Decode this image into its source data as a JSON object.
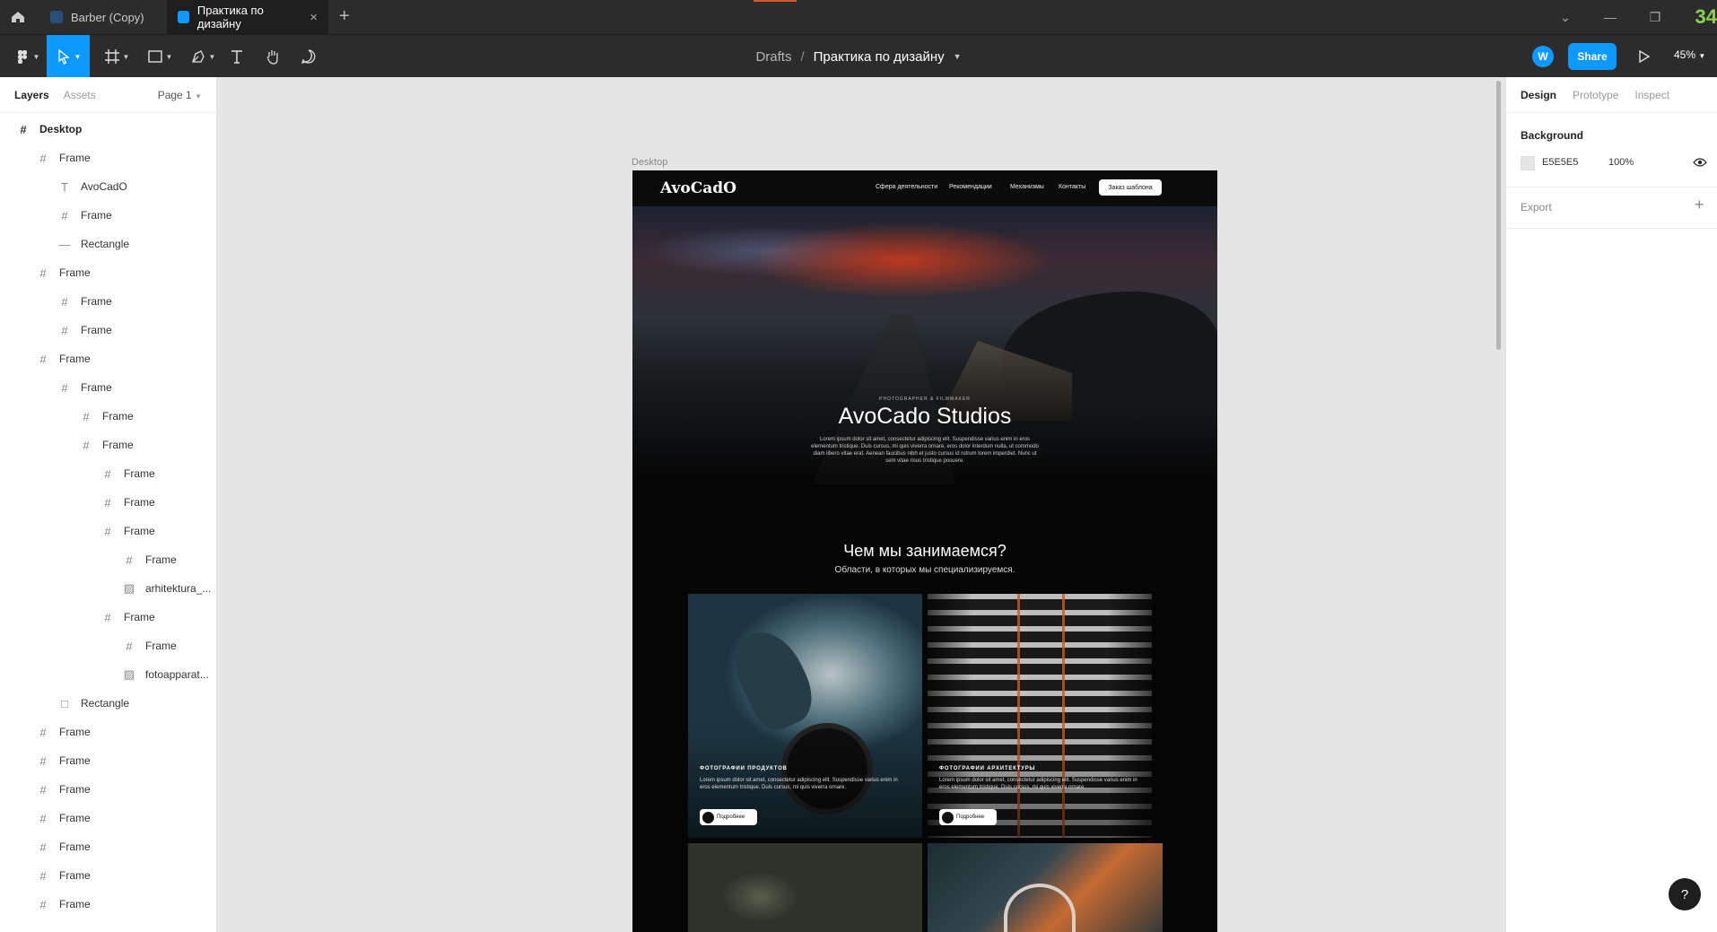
{
  "titlebar": {
    "tabs": [
      {
        "label": "Barber (Copy)"
      },
      {
        "label": "Практика по дизайну"
      }
    ],
    "corner_number": "34",
    "accent_color": "#8bd34a"
  },
  "toolbar": {
    "breadcrumb_root": "Drafts",
    "breadcrumb_sep": "/",
    "file_name": "Практика по дизайну",
    "avatar_initial": "W",
    "share_label": "Share",
    "zoom": "45%",
    "accent_color": "#0d99ff"
  },
  "left_panel": {
    "tab_layers": "Layers",
    "tab_assets": "Assets",
    "page": "Page 1",
    "layers": [
      {
        "name": "Desktop",
        "icon": "frame-icon"
      },
      {
        "name": "Frame",
        "icon": "frame-icon"
      },
      {
        "name": "AvoCadO",
        "icon": "text-icon"
      },
      {
        "name": "Frame",
        "icon": "frame-icon"
      },
      {
        "name": "Rectangle",
        "icon": "line-icon"
      },
      {
        "name": "Frame",
        "icon": "frame-icon"
      },
      {
        "name": "Frame",
        "icon": "frame-icon"
      },
      {
        "name": "Frame",
        "icon": "frame-icon"
      },
      {
        "name": "Frame",
        "icon": "frame-icon"
      },
      {
        "name": "Frame",
        "icon": "frame-icon"
      },
      {
        "name": "Frame",
        "icon": "frame-icon"
      },
      {
        "name": "Frame",
        "icon": "frame-icon"
      },
      {
        "name": "Frame",
        "icon": "frame-icon"
      },
      {
        "name": "Frame",
        "icon": "frame-icon"
      },
      {
        "name": "Frame",
        "icon": "frame-icon"
      },
      {
        "name": "Frame",
        "icon": "frame-icon"
      },
      {
        "name": "arhitektura_...",
        "icon": "image-icon"
      },
      {
        "name": "Frame",
        "icon": "frame-icon"
      },
      {
        "name": "Frame",
        "icon": "frame-icon"
      },
      {
        "name": "fotoapparat...",
        "icon": "image-icon"
      },
      {
        "name": "Rectangle",
        "icon": "rectangle-icon"
      },
      {
        "name": "Frame",
        "icon": "frame-icon"
      },
      {
        "name": "Frame",
        "icon": "frame-icon"
      },
      {
        "name": "Frame",
        "icon": "frame-icon"
      },
      {
        "name": "Frame",
        "icon": "frame-icon"
      },
      {
        "name": "Frame",
        "icon": "frame-icon"
      },
      {
        "name": "Frame",
        "icon": "frame-icon"
      },
      {
        "name": "Frame",
        "icon": "frame-icon"
      }
    ]
  },
  "canvas": {
    "frame_label": "Desktop",
    "site": {
      "logo": "AvoCadO",
      "nav": [
        "Сфера деятельности",
        "Рекомендации",
        "Механизмы",
        "Контакты"
      ],
      "cta": "Заказ шаблона",
      "hero_sub": "PHOTOGRAPHER & FILMMAKER",
      "hero_title": "AvoCado Studios",
      "hero_desc": "Lorem ipsum dolor sit amet, consectetur adipiscing elit. Suspendisse varius enim in eros elementum tristique. Duis cursus, mi quis viverra ornare, eros dolor interdum nulla, ut commodo diam libero vitae erat. Aenean faucibus nibh et justo cursus id rutrum lorem imperdiet. Nunc ut sem vitae risus tristique posuere.",
      "section_title": "Чем мы занимаемся?",
      "section_sub": "Области, в которых мы специализируемся.",
      "cards": [
        {
          "title": "ФОТОГРАФИИ ПРОДУКТОВ",
          "desc": "Lorem ipsum dolor sit amet, consectetur adipiscing elit. Suspendisse varius enim in eros elementum tristique. Duis cursus, mi quis viverra ornare.",
          "button": "Подробнее"
        },
        {
          "title": "ФОТОГРАФИИ АРХИТЕКТУРЫ",
          "desc": "Lorem ipsum dolor sit amet, consectetur adipiscing elit. Suspendisse varius enim in eros elementum tristique. Duis cursus, mi quis viverra ornare.",
          "button": "Подробнее"
        }
      ]
    }
  },
  "right_panel": {
    "tab_design": "Design",
    "tab_prototype": "Prototype",
    "tab_inspect": "Inspect",
    "background_heading": "Background",
    "background_hex": "E5E5E5",
    "background_opacity": "100%",
    "export_label": "Export"
  },
  "help_label": "?"
}
